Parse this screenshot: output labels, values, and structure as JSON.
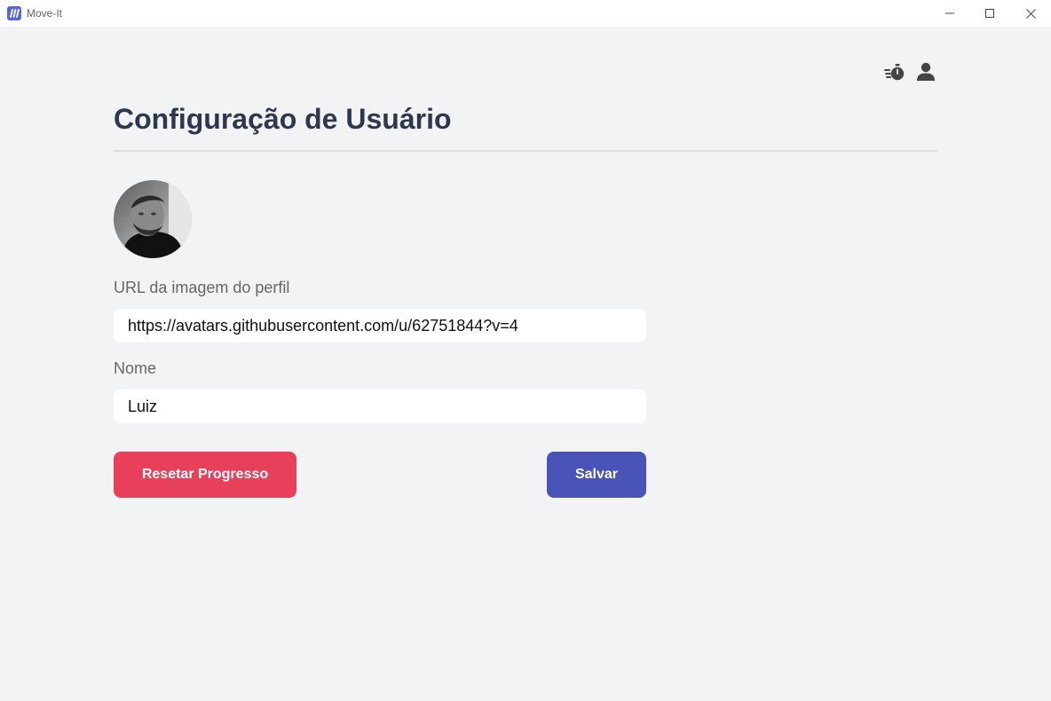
{
  "window": {
    "title": "Move-It",
    "controls": [
      "minimize-icon",
      "maximize-icon",
      "close-icon"
    ]
  },
  "header": {
    "icons": [
      "stopwatch-icon",
      "user-icon"
    ]
  },
  "page": {
    "title": "Configuração de Usuário"
  },
  "form": {
    "avatar_icon": "profile-photo",
    "url_label": "URL da imagem do perfil",
    "url_value": "https://avatars.githubusercontent.com/u/62751844?v=4",
    "name_label": "Nome",
    "name_value": "Luiz"
  },
  "actions": {
    "reset_label": "Resetar Progresso",
    "save_label": "Salvar"
  },
  "colors": {
    "background": "#f2f3f5",
    "title": "#2e384d",
    "reset": "#e83f5b",
    "save": "#4953b8",
    "brand": "#5965e0"
  }
}
